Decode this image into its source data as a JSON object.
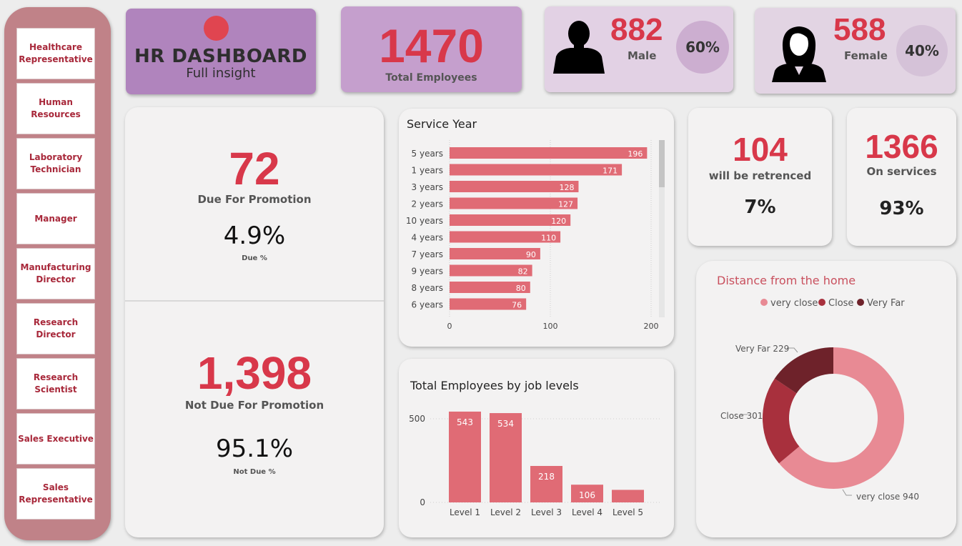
{
  "sidebar": {
    "items": [
      {
        "label_1": "Healthcare",
        "label_2": "Representative"
      },
      {
        "label_1": "Human",
        "label_2": "Resources"
      },
      {
        "label_1": "Laboratory",
        "label_2": "Technician"
      },
      {
        "label_1": "Manager",
        "label_2": ""
      },
      {
        "label_1": "Manufacturing",
        "label_2": "Director"
      },
      {
        "label_1": "Research",
        "label_2": "Director"
      },
      {
        "label_1": "Research",
        "label_2": "Scientist"
      },
      {
        "label_1": "Sales Executive",
        "label_2": ""
      },
      {
        "label_1": "Sales",
        "label_2": "Representative"
      }
    ]
  },
  "header": {
    "title": "HR DASHBOARD",
    "subtitle": "Full insight"
  },
  "kpis": {
    "total": {
      "value": "1470",
      "label": "Total Employees"
    },
    "male": {
      "value": "882",
      "label": "Male",
      "percent": "60%"
    },
    "female": {
      "value": "588",
      "label": "Female",
      "percent": "40%"
    },
    "promotion_due": {
      "value": "72",
      "label": "Due For Promotion",
      "percent": "4.9%",
      "percent_label": "Due %"
    },
    "promotion_not_due": {
      "value": "1,398",
      "label": "Not Due For Promotion",
      "percent": "95.1%",
      "percent_label": "Not Due %"
    },
    "retrenched": {
      "value": "104",
      "label": "will be retrenced",
      "percent": "7%"
    },
    "on_service": {
      "value": "1366",
      "label": "On services",
      "percent": "93%"
    }
  },
  "colors": {
    "accent": "#d8384a",
    "bar": "#e06b75",
    "very_close": "#e88a94",
    "close": "#a8303d",
    "very_far": "#6e222a",
    "sidebar": "#c08288"
  },
  "icons": {
    "male": "male-silhouette-icon",
    "female": "female-silhouette-icon",
    "header_dot": "red-dot-icon"
  },
  "chart_data": [
    {
      "type": "bar",
      "orientation": "horizontal",
      "title": "Service Year",
      "categories": [
        "5 years",
        "1 years",
        "3 years",
        "2 years",
        "10 years",
        "4 years",
        "7 years",
        "9 years",
        "8 years",
        "6 years"
      ],
      "values": [
        196,
        171,
        128,
        127,
        120,
        110,
        90,
        82,
        80,
        76
      ],
      "xlim": [
        0,
        200
      ],
      "xticks": [
        "0",
        "100",
        "200"
      ],
      "grid": true
    },
    {
      "type": "bar",
      "title": "Total Employees by job levels",
      "categories": [
        "Level 1",
        "Level 2",
        "Level 3",
        "Level 4",
        "Level 5"
      ],
      "values": [
        543,
        534,
        218,
        106,
        75
      ],
      "data_labels": [
        "543",
        "534",
        "218",
        "106",
        ""
      ],
      "ylim": [
        0,
        600
      ],
      "yticks": [
        "0",
        "500"
      ],
      "grid": true
    },
    {
      "type": "pie",
      "donut": true,
      "title": "Distance from the home",
      "legend_position": "top",
      "categories": [
        "very close",
        "Close",
        "Very Far"
      ],
      "values": [
        940,
        301,
        229
      ],
      "slice_labels": [
        "very close 940",
        "Close 301",
        "Very Far 229"
      ]
    }
  ]
}
